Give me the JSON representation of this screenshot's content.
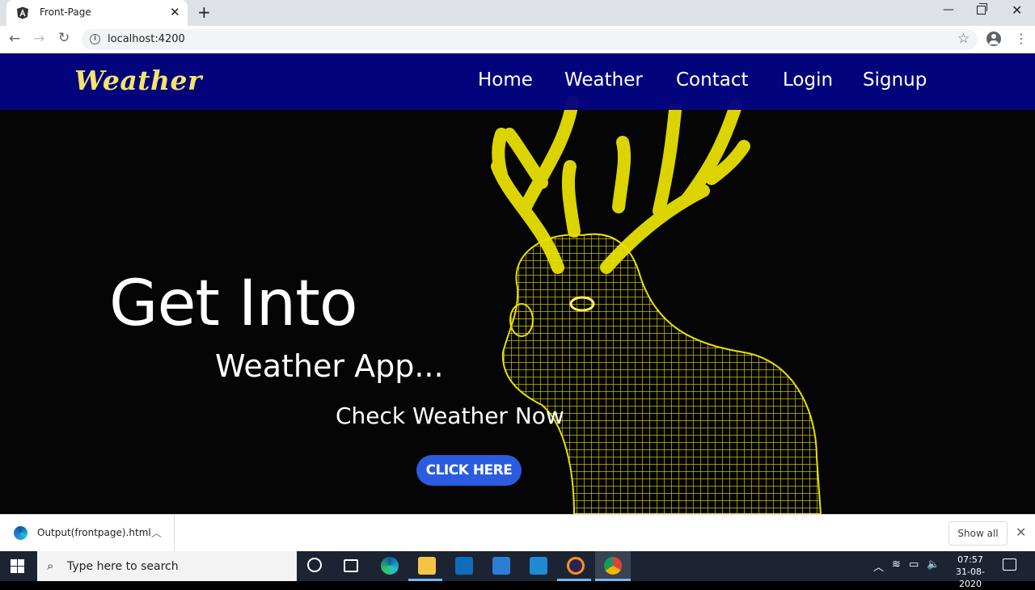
{
  "browser": {
    "tab_title": "Front-Page",
    "url": "localhost:4200"
  },
  "site": {
    "logo": "Weather",
    "nav": [
      "Home",
      "Weather",
      "Contact",
      "Login",
      "Signup"
    ],
    "hero": {
      "title": "Get Into",
      "subtitle": "Weather App...",
      "cta_text": "Check Weather Now",
      "button": "CLICK HERE"
    },
    "colors": {
      "navbar": "#030380",
      "logo": "#f5e36b",
      "button": "#2b5ce0",
      "deer": "#e8e000"
    }
  },
  "downloads": {
    "file": "Output(frontpage).html",
    "show_all": "Show all"
  },
  "taskbar": {
    "search_placeholder": "Type here to search",
    "time": "07:57",
    "date": "31-08-2020",
    "apps": [
      "task-view",
      "edge",
      "file-explorer",
      "store",
      "mail",
      "vscode",
      "eclipse",
      "chrome"
    ]
  }
}
